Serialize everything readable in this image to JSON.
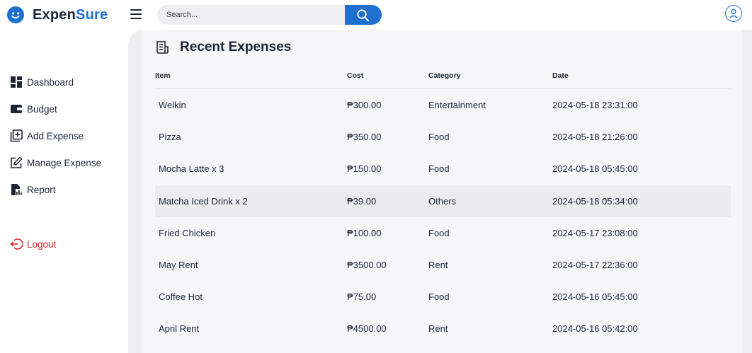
{
  "app": {
    "brand_prefix": "Expen",
    "brand_suffix": "Sure",
    "accent_color": "#1e6fd0",
    "logout_color": "#d62222"
  },
  "search": {
    "placeholder": "Search..."
  },
  "sidebar": {
    "items": [
      {
        "label": "Dashboard",
        "icon": "dashboard-icon"
      },
      {
        "label": "Budget",
        "icon": "wallet-icon"
      },
      {
        "label": "Add Expense",
        "icon": "add-square-icon"
      },
      {
        "label": "Manage Expense",
        "icon": "edit-icon"
      },
      {
        "label": "Report",
        "icon": "report-icon"
      }
    ],
    "logout": {
      "label": "Logout",
      "icon": "logout-icon"
    }
  },
  "main": {
    "title": "Recent Expenses",
    "columns": [
      "Item",
      "Cost",
      "Category",
      "Date"
    ],
    "rows": [
      {
        "item": "Welkin",
        "cost": "₱300.00",
        "category": "Entertainment",
        "date": "2024-05-18 23:31:00"
      },
      {
        "item": "Pizza",
        "cost": "₱350.00",
        "category": "Food",
        "date": "2024-05-18 21:26:00"
      },
      {
        "item": "Mocha Latte x 3",
        "cost": "₱150.00",
        "category": "Food",
        "date": "2024-05-18 05:45:00"
      },
      {
        "item": "Matcha Iced Drink x 2",
        "cost": "₱39.00",
        "category": "Others",
        "date": "2024-05-18 05:34:00"
      },
      {
        "item": "Fried Chicken",
        "cost": "₱100.00",
        "category": "Food",
        "date": "2024-05-17 23:08:00"
      },
      {
        "item": "May Rent",
        "cost": "₱3500.00",
        "category": "Rent",
        "date": "2024-05-17 22:36:00"
      },
      {
        "item": "Coffee Hot",
        "cost": "₱75.00",
        "category": "Food",
        "date": "2024-05-16 05:45:00"
      },
      {
        "item": "April Rent",
        "cost": "₱4500.00",
        "category": "Rent",
        "date": "2024-05-16 05:42:00"
      }
    ]
  }
}
